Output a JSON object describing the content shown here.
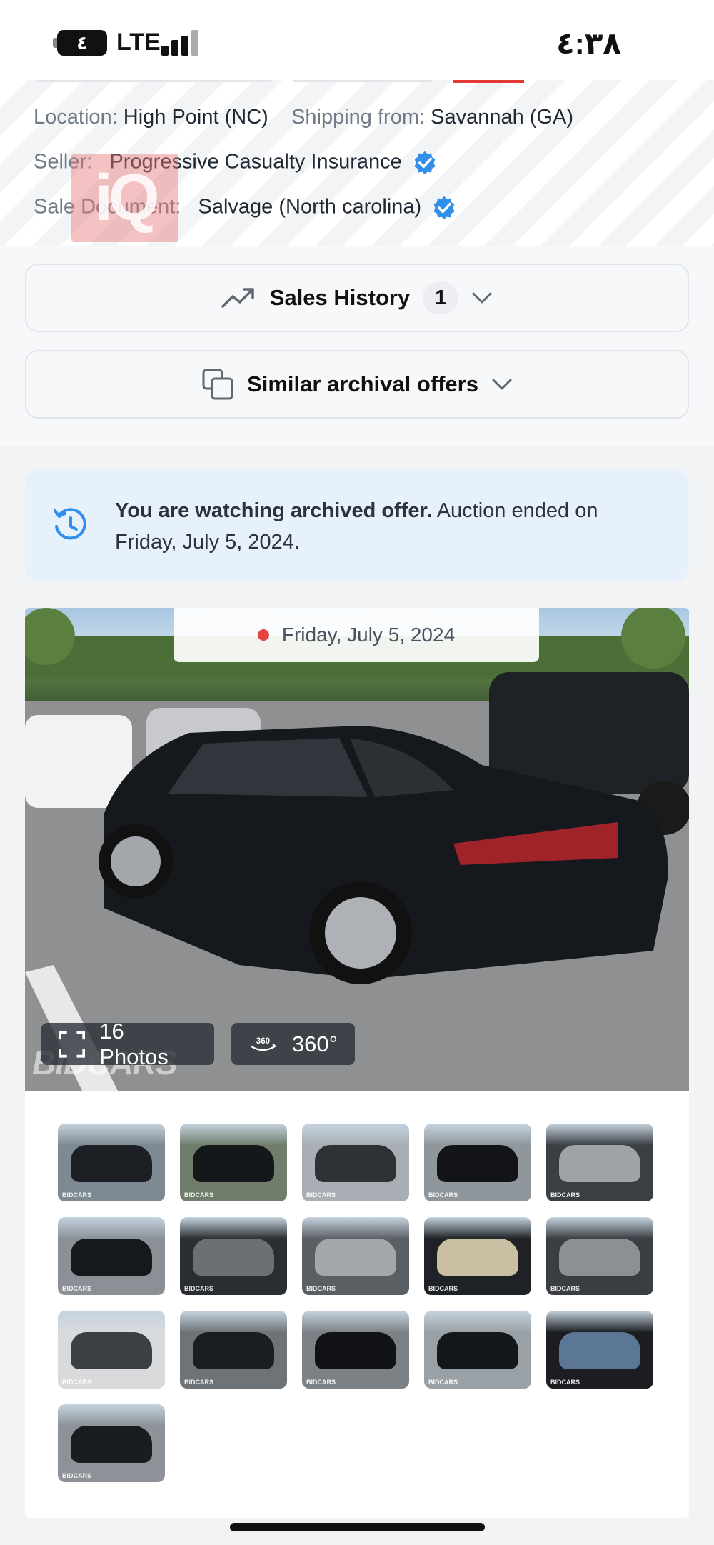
{
  "status_bar": {
    "battery": "٤",
    "network": "LTE",
    "time": "٤:٣٨"
  },
  "info": {
    "location_label": "Location:",
    "location_value": "High Point (NC)",
    "shipping_label": "Shipping from:",
    "shipping_value": "Savannah (GA)",
    "seller_label": "Seller:",
    "seller_value": "Progressive Casualty Insurance",
    "sale_doc_label": "Sale Document:",
    "sale_doc_value": "Salvage (North carolina)",
    "watermark_logo": "iQ"
  },
  "sales_history": {
    "label": "Sales History",
    "count": "1"
  },
  "similar": {
    "label": "Similar archival offers"
  },
  "archived": {
    "bold": "You are watching archived offer.",
    "rest": " Auction ended on Friday, July 5, 2024."
  },
  "gallery": {
    "date": "Friday, July 5, 2024",
    "photos_label": "16 Photos",
    "view360_label": "360°",
    "badge_360": "360",
    "watermark": "BIDCARS",
    "thumb_brand": "BIDCARS",
    "thumbnails": [
      {
        "name": "front-damage-left"
      },
      {
        "name": "front-left-lot"
      },
      {
        "name": "rear-left-gray"
      },
      {
        "name": "rear-left-black"
      },
      {
        "name": "interior-seats"
      },
      {
        "name": "front-damage-right"
      },
      {
        "name": "instrument-cluster"
      },
      {
        "name": "rear-seats"
      },
      {
        "name": "door-label"
      },
      {
        "name": "engine-bay"
      },
      {
        "name": "airbag-deployed"
      },
      {
        "name": "front-bumper"
      },
      {
        "name": "side-profile-left"
      },
      {
        "name": "side-profile-black"
      },
      {
        "name": "odometer"
      },
      {
        "name": "rear-view"
      }
    ]
  },
  "colors": {
    "accent_blue": "#2f8fea",
    "banner_bg": "#e6f1fc",
    "live_dot": "#e5433f"
  }
}
